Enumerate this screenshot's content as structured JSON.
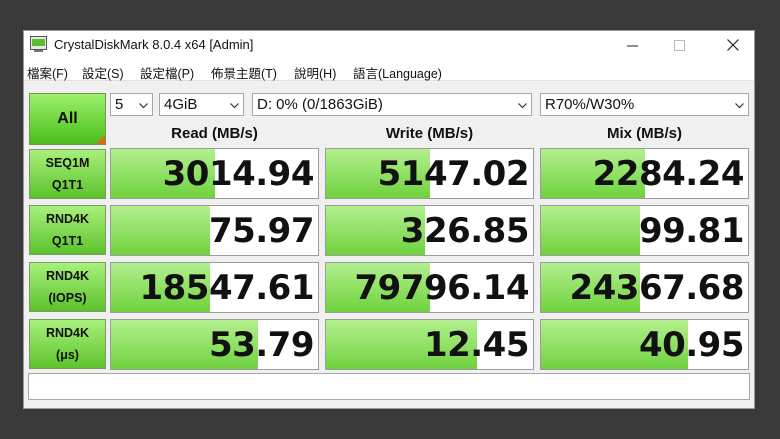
{
  "window": {
    "title": "CrystalDiskMark 8.0.4 x64 [Admin]"
  },
  "menu": [
    "檔案(F)",
    "設定(S)",
    "設定檔(P)",
    "佈景主題(T)",
    "說明(H)",
    "語言(Language)"
  ],
  "controls": {
    "all_label": "All",
    "count": "5",
    "size": "4GiB",
    "drive": "D: 0% (0/1863GiB)",
    "mix_mode": "R70%/W30%"
  },
  "headers": {
    "read": "Read (MB/s)",
    "write": "Write (MB/s)",
    "mix": "Mix (MB/s)"
  },
  "rows": [
    {
      "line1": "SEQ1M",
      "line2": "Q1T1",
      "read": "3014.94",
      "write": "5147.02",
      "mix": "2284.24",
      "read_fill": 0.5,
      "write_fill": 0.5,
      "mix_fill": 0.5
    },
    {
      "line1": "RND4K",
      "line2": "Q1T1",
      "read": "75.97",
      "write": "326.85",
      "mix": "99.81",
      "read_fill": 0.48,
      "write_fill": 0.48,
      "mix_fill": 0.48
    },
    {
      "line1": "RND4K",
      "line2": "(IOPS)",
      "read": "18547.61",
      "write": "79796.14",
      "mix": "24367.68",
      "read_fill": 0.48,
      "write_fill": 0.5,
      "mix_fill": 0.48
    },
    {
      "line1": "RND4K",
      "line2": "(μs)",
      "read": "53.79",
      "write": "12.45",
      "mix": "40.95",
      "read_fill": 0.71,
      "write_fill": 0.73,
      "mix_fill": 0.71
    }
  ],
  "status_text": "",
  "colors": {
    "bar_green": "#6fd23e",
    "button_green": "#5cc32b",
    "corner_orange": "#e06a12"
  }
}
